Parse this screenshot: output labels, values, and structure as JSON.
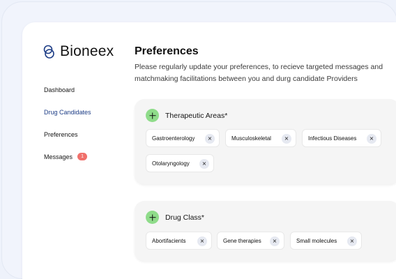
{
  "brand": {
    "name": "Bioneex"
  },
  "sidebar": {
    "items": [
      {
        "label": "Dashboard"
      },
      {
        "label": "Drug Candidates"
      },
      {
        "label": "Preferences"
      },
      {
        "label": "Messages",
        "badge": "1"
      }
    ]
  },
  "main": {
    "title": "Preferences",
    "subtitle": "Please regularly update your preferences, to recieve targeted messages and matchmaking facilitations between you and durg candidate Providers",
    "sections": [
      {
        "title": "Therapeutic Areas*",
        "chips": [
          "Gastroenterology",
          "Musculoskeletal",
          "Infectious Diseases",
          "Otolaryngology"
        ]
      },
      {
        "title": "Drug Class*",
        "chips": [
          "Abortifacients",
          "Gene therapies",
          "Small molecules"
        ]
      }
    ]
  },
  "colors": {
    "accent_green": "#8fdc8a",
    "nav_active": "#1d3d86",
    "badge": "#f0706b"
  },
  "icons": {
    "remove": "close-icon",
    "add": "plus-icon"
  },
  "glyphs": {
    "remove": "×"
  }
}
